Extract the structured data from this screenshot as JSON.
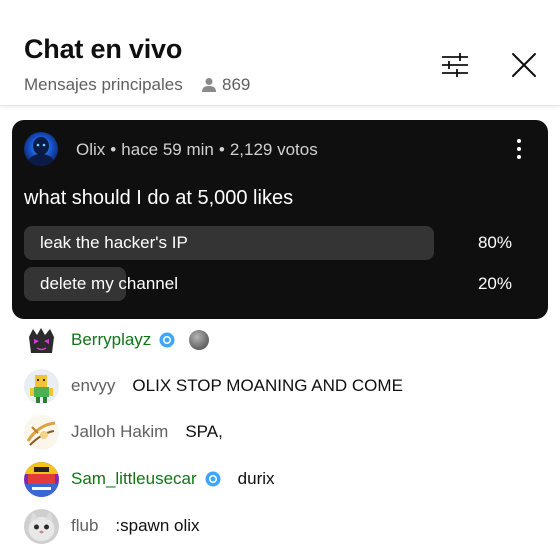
{
  "header": {
    "title": "Chat en vivo",
    "subtitle": "Mensajes principales",
    "viewer_count": "869"
  },
  "poll": {
    "author": "Olix",
    "time": "hace 59 min",
    "votes": "2,129 votos",
    "question": "what should I do at 5,000 likes",
    "options": [
      {
        "label": "leak the hacker's IP",
        "percent_text": "80%",
        "percent": 80
      },
      {
        "label": "delete my channel",
        "percent_text": "20%",
        "percent": 20
      }
    ]
  },
  "chat": {
    "messages": [
      {
        "author": "Berryplayz",
        "member": true,
        "verified": true,
        "message": "",
        "emoji": "grey-face-emoji"
      },
      {
        "author": "envyy",
        "member": false,
        "verified": false,
        "message": "OLIX STOP MOANING AND COME"
      },
      {
        "author": "Jalloh Hakim",
        "member": false,
        "verified": false,
        "message": "SPA,"
      },
      {
        "author": "Sam_littleusecar",
        "member": true,
        "verified": true,
        "message": "durix"
      },
      {
        "author": "flub",
        "member": false,
        "verified": false,
        "message": ":spawn olix"
      }
    ]
  },
  "colors": {
    "member_name": "#107516",
    "verified_badge": "#3ea6ff",
    "poll_background": "#0f0f0f",
    "poll_fill": "#343434"
  },
  "icons": [
    "person-icon",
    "filter-icon",
    "close-icon",
    "more-vert-icon",
    "verified-icon"
  ]
}
